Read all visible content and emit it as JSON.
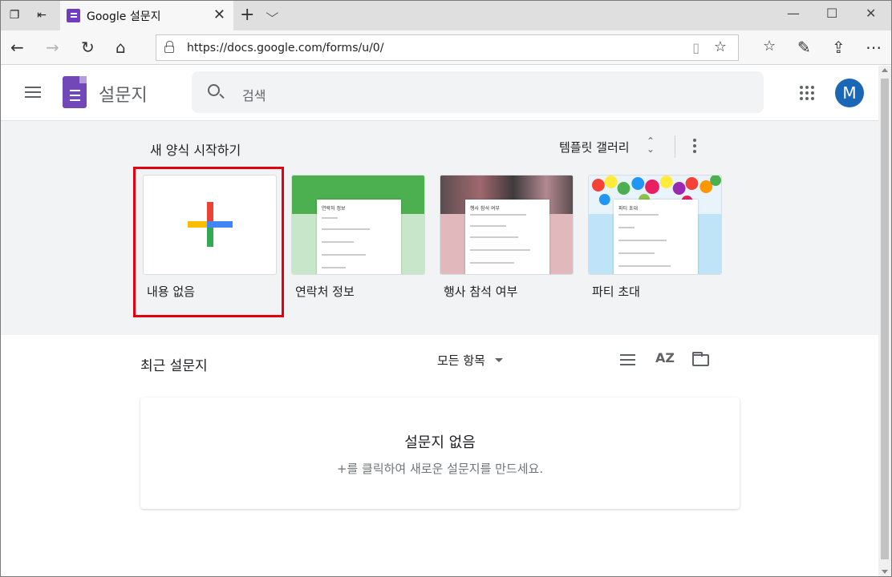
{
  "browser": {
    "tab_title": "Google 설문지",
    "url": "https://docs.google.com/forms/u/0/"
  },
  "app": {
    "name": "설문지",
    "search_placeholder": "검색",
    "avatar_initial": "M",
    "logo_color": "#7248b9",
    "avatar_color": "#1967b5"
  },
  "templates": {
    "section_title": "새 양식 시작하기",
    "gallery_label": "템플릿 갤러리",
    "items": [
      {
        "label": "내용 없음",
        "icon": "plus-icon",
        "highlighted": true
      },
      {
        "label": "연락처 정보",
        "color": "#4caf50",
        "form_title": "연락처 정보"
      },
      {
        "label": "행사 참석 여부",
        "color": "#e1b9bd",
        "form_title": "행사 참석 여부"
      },
      {
        "label": "파티 초대",
        "color": "#bfe4f7",
        "form_title": "파티 초대"
      }
    ]
  },
  "recent": {
    "title": "최근 설문지",
    "owner_filter": "모든 항목",
    "sort_label": "AZ",
    "empty_title": "설문지 없음",
    "empty_subtitle": "+를 클릭하여 새로운 설문지를 만드세요."
  },
  "icons": {
    "close": "✕",
    "new_tab": "+",
    "tab_list": "⌵",
    "back": "←",
    "forward": "→",
    "refresh": "↻",
    "home": "⌂",
    "reader": "▯",
    "favorite": "☆",
    "favorites": "☆",
    "pen": "✎",
    "share": "⇪",
    "more": "⋯",
    "minimize": "—",
    "maximize": "☐",
    "window_close": "✕",
    "gallery_toggle": "⌃⌄"
  }
}
